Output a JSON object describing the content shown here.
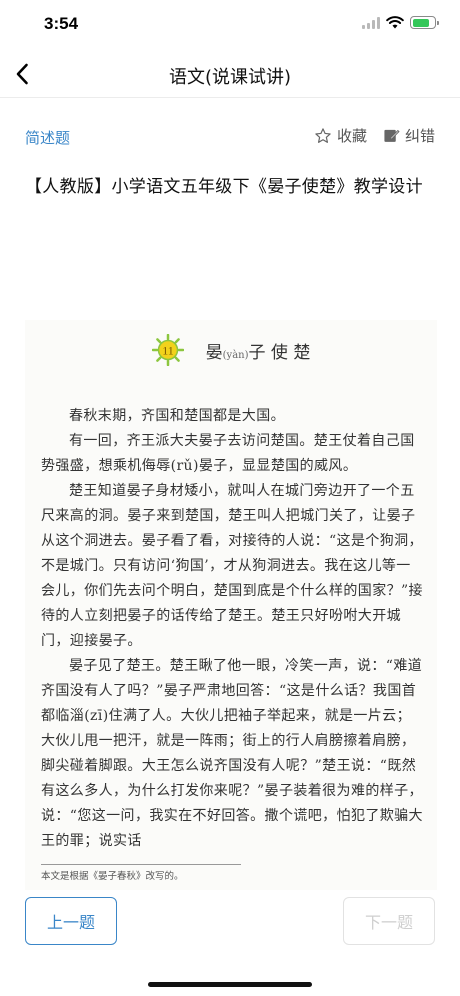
{
  "status": {
    "time": "3:54"
  },
  "nav": {
    "title": "语文(说课试讲)",
    "back_icon": "chevron-left-icon"
  },
  "question": {
    "type": "简述题",
    "favorite_label": "收藏",
    "favorite_icon": "star-icon",
    "report_label": "纠错",
    "report_icon": "edit-icon",
    "title": "【人教版】小学语文五年级下《晏子使楚》教学设计"
  },
  "lesson_image": {
    "number": "11",
    "heading_pre": "晏",
    "heading_pinyin": "(yàn)",
    "heading_post": "子 使 楚",
    "paragraphs": [
      "春秋末期，齐国和楚国都是大国。",
      "有一回，齐王派大夫晏子去访问楚国。楚王仗着自己国势强盛，想乘机侮辱(rǔ)晏子，显显楚国的威风。",
      "楚王知道晏子身材矮小，就叫人在城门旁边开了一个五尺来高的洞。晏子来到楚国，楚王叫人把城门关了，让晏子从这个洞进去。晏子看了看，对接待的人说：“这是个狗洞，不是城门。只有访问‘狗国’，才从狗洞进去。我在这儿等一会儿，你们先去问个明白，楚国到底是个什么样的国家？”接待的人立刻把晏子的话传给了楚王。楚王只好吩咐大开城门，迎接晏子。",
      "晏子见了楚王。楚王瞅了他一眼，冷笑一声，说：“难道齐国没有人了吗？”晏子严肃地回答：“这是什么话？我国首都临淄(zī)住满了人。大伙儿把袖子举起来，就是一片云；大伙儿甩一把汗，就是一阵雨；街上的行人肩膀擦着肩膀，脚尖碰着脚跟。大王怎么说齐国没有人呢？”楚王说：“既然有这么多人，为什么打发你来呢？”晏子装着很为难的样子，说：“您这一问，我实在不好回答。撒个谎吧，怕犯了欺骗大王的罪；说实话"
    ],
    "footnote": "本文是根据《晏子春秋》改写的。"
  },
  "footer": {
    "prev_label": "上一题",
    "next_label": "下一题"
  },
  "colors": {
    "accent": "#3a86c8",
    "disabled": "#cfcfcf",
    "battery": "#34c759"
  }
}
